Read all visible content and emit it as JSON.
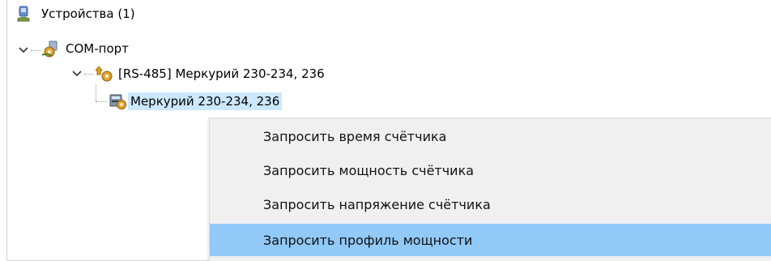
{
  "tree": {
    "root": {
      "label": "Устройства (1)",
      "icon": "devices-icon"
    },
    "port": {
      "label": "COM-порт",
      "icon": "com-port-icon"
    },
    "bus": {
      "label": "[RS-485] Меркурий 230-234, 236",
      "icon": "bus-device-icon"
    },
    "meter": {
      "label": "Меркурий 230-234, 236",
      "icon": "meter-icon",
      "selected": true
    }
  },
  "context_menu": {
    "items": [
      {
        "label": "Запросить время счётчика"
      },
      {
        "label": "Запросить мощность счётчика"
      },
      {
        "label": "Запросить напряжение счётчика"
      },
      {
        "label": "Запросить профиль мощности",
        "highlighted": true
      }
    ]
  },
  "colors": {
    "selection": "#cce8ff",
    "menu_background": "#f0f0f0",
    "menu_highlight": "#91c9f7"
  }
}
